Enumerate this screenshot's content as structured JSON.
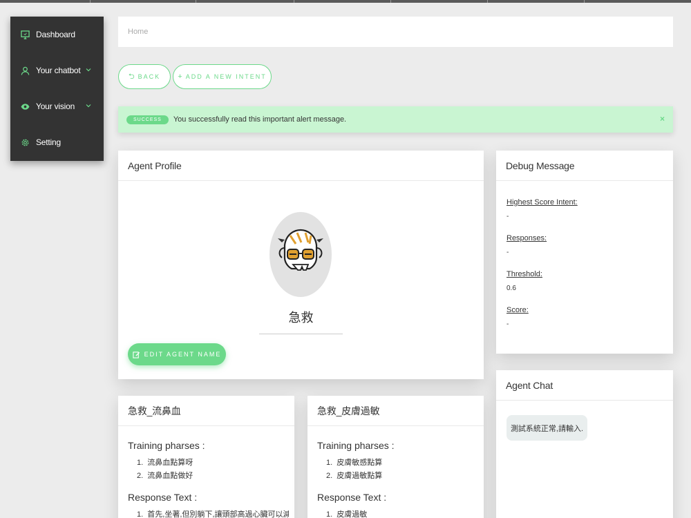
{
  "sidebar": {
    "items": [
      {
        "label": "Dashboard",
        "icon": "monitor-icon"
      },
      {
        "label": "Your chatbot",
        "icon": "user-icon"
      },
      {
        "label": "Your vision",
        "icon": "eye-icon"
      },
      {
        "label": "Setting",
        "icon": "gear-icon"
      }
    ]
  },
  "breadcrumb": {
    "home": "Home"
  },
  "toolbar": {
    "back_label": "BACK",
    "back_icon": "⮌",
    "add_intent_label": "ADD A NEW INTENT",
    "add_icon": "+"
  },
  "alert": {
    "badge": "SUCCESS",
    "message": "You successfully read this important alert message.",
    "close": "×"
  },
  "agent_profile": {
    "title": "Agent Profile",
    "name": "急救",
    "edit_label": "EDIT AGENT NAME"
  },
  "debug": {
    "title": "Debug Message",
    "fields": [
      {
        "key": "Highest Score Intent:",
        "value": "-"
      },
      {
        "key": "Responses:",
        "value": "-"
      },
      {
        "key": "Threshold:",
        "value": "0.6"
      },
      {
        "key": "Score:",
        "value": "-"
      }
    ]
  },
  "chat": {
    "title": "Agent Chat",
    "message": "測試系統正常,請輸入."
  },
  "intents": [
    {
      "title": "急救_流鼻血",
      "training_label": "Training pharses :",
      "phrases": [
        "流鼻血點算呀",
        "流鼻血點做好"
      ],
      "response_label": "Response Text :",
      "responses": [
        "首先,坐著,但別躺下,讓頭部高過心臟可以減少"
      ]
    },
    {
      "title": "急救_皮膚過敏",
      "training_label": "Training pharses :",
      "phrases": [
        "皮膚敏感點算",
        "皮膚過敏點算"
      ],
      "response_label": "Response Text :",
      "responses": [
        "皮膚過敏"
      ]
    }
  ],
  "colors": {
    "accent": "#6cd98a",
    "sidebar": "#333333",
    "alert_bg": "#c9f5d2"
  }
}
